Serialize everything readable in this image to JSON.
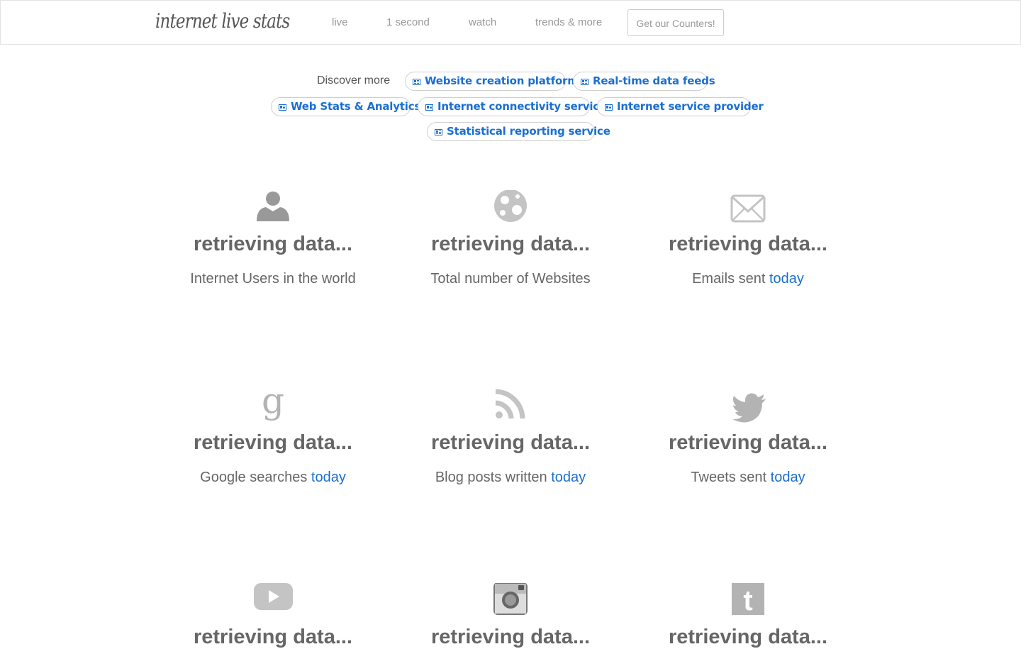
{
  "header": {
    "logo": "internet live stats",
    "nav": [
      "live",
      "1 second",
      "watch",
      "trends & more"
    ],
    "cta": "Get our Counters!"
  },
  "discover": {
    "label": "Discover more",
    "chips": [
      "Website creation platform",
      "Real-time data feeds",
      "Web Stats & Analytics",
      "Internet connectivity service",
      "Internet service provider",
      "Statistical reporting service"
    ]
  },
  "stats": [
    {
      "icon": "user-icon",
      "value": "retrieving data...",
      "label": "Internet Users in the world",
      "highlight": ""
    },
    {
      "icon": "globe-icon",
      "value": "retrieving data...",
      "label": "Total number of Websites",
      "highlight": ""
    },
    {
      "icon": "envelope-icon",
      "value": "retrieving data...",
      "label": "Emails sent",
      "highlight": "today"
    },
    {
      "icon": "google-icon",
      "value": "retrieving data...",
      "label": "Google searches",
      "highlight": "today"
    },
    {
      "icon": "rss-icon",
      "value": "retrieving data...",
      "label": "Blog posts written",
      "highlight": "today"
    },
    {
      "icon": "twitter-bird-icon",
      "value": "retrieving data...",
      "label": "Tweets sent",
      "highlight": "today"
    },
    {
      "icon": "youtube-icon",
      "value": "retrieving data...",
      "label": "",
      "highlight": ""
    },
    {
      "icon": "instagram-icon",
      "value": "retrieving data...",
      "label": "",
      "highlight": ""
    },
    {
      "icon": "tumblr-icon",
      "value": "retrieving data...",
      "label": "",
      "highlight": ""
    }
  ],
  "colors": {
    "link": "#1a6fd1",
    "text": "#666666",
    "icon": "#b3b3b3"
  }
}
